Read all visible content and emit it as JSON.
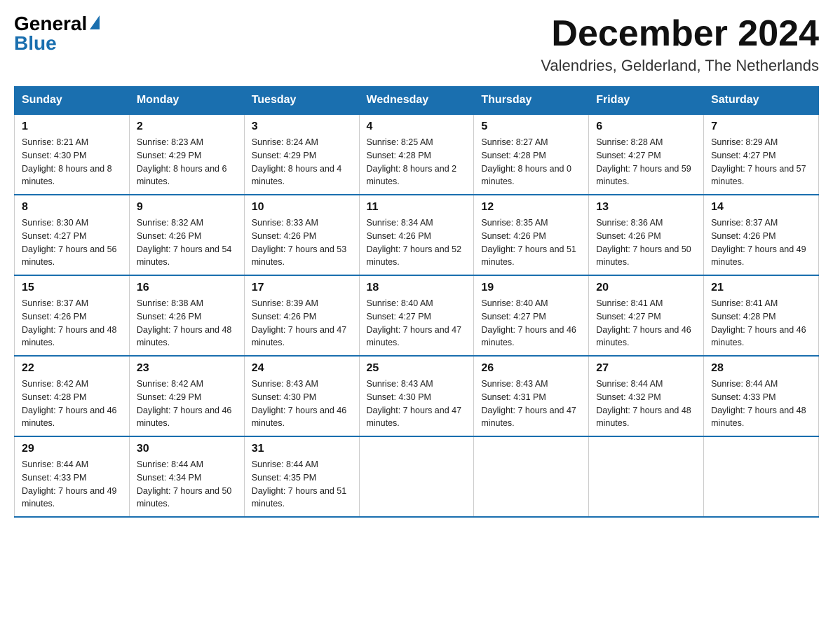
{
  "logo": {
    "general": "General",
    "blue": "Blue"
  },
  "title": {
    "month": "December 2024",
    "location": "Valendries, Gelderland, The Netherlands"
  },
  "weekdays": [
    "Sunday",
    "Monday",
    "Tuesday",
    "Wednesday",
    "Thursday",
    "Friday",
    "Saturday"
  ],
  "weeks": [
    [
      {
        "day": "1",
        "sunrise": "8:21 AM",
        "sunset": "4:30 PM",
        "daylight": "8 hours and 8 minutes."
      },
      {
        "day": "2",
        "sunrise": "8:23 AM",
        "sunset": "4:29 PM",
        "daylight": "8 hours and 6 minutes."
      },
      {
        "day": "3",
        "sunrise": "8:24 AM",
        "sunset": "4:29 PM",
        "daylight": "8 hours and 4 minutes."
      },
      {
        "day": "4",
        "sunrise": "8:25 AM",
        "sunset": "4:28 PM",
        "daylight": "8 hours and 2 minutes."
      },
      {
        "day": "5",
        "sunrise": "8:27 AM",
        "sunset": "4:28 PM",
        "daylight": "8 hours and 0 minutes."
      },
      {
        "day": "6",
        "sunrise": "8:28 AM",
        "sunset": "4:27 PM",
        "daylight": "7 hours and 59 minutes."
      },
      {
        "day": "7",
        "sunrise": "8:29 AM",
        "sunset": "4:27 PM",
        "daylight": "7 hours and 57 minutes."
      }
    ],
    [
      {
        "day": "8",
        "sunrise": "8:30 AM",
        "sunset": "4:27 PM",
        "daylight": "7 hours and 56 minutes."
      },
      {
        "day": "9",
        "sunrise": "8:32 AM",
        "sunset": "4:26 PM",
        "daylight": "7 hours and 54 minutes."
      },
      {
        "day": "10",
        "sunrise": "8:33 AM",
        "sunset": "4:26 PM",
        "daylight": "7 hours and 53 minutes."
      },
      {
        "day": "11",
        "sunrise": "8:34 AM",
        "sunset": "4:26 PM",
        "daylight": "7 hours and 52 minutes."
      },
      {
        "day": "12",
        "sunrise": "8:35 AM",
        "sunset": "4:26 PM",
        "daylight": "7 hours and 51 minutes."
      },
      {
        "day": "13",
        "sunrise": "8:36 AM",
        "sunset": "4:26 PM",
        "daylight": "7 hours and 50 minutes."
      },
      {
        "day": "14",
        "sunrise": "8:37 AM",
        "sunset": "4:26 PM",
        "daylight": "7 hours and 49 minutes."
      }
    ],
    [
      {
        "day": "15",
        "sunrise": "8:37 AM",
        "sunset": "4:26 PM",
        "daylight": "7 hours and 48 minutes."
      },
      {
        "day": "16",
        "sunrise": "8:38 AM",
        "sunset": "4:26 PM",
        "daylight": "7 hours and 48 minutes."
      },
      {
        "day": "17",
        "sunrise": "8:39 AM",
        "sunset": "4:26 PM",
        "daylight": "7 hours and 47 minutes."
      },
      {
        "day": "18",
        "sunrise": "8:40 AM",
        "sunset": "4:27 PM",
        "daylight": "7 hours and 47 minutes."
      },
      {
        "day": "19",
        "sunrise": "8:40 AM",
        "sunset": "4:27 PM",
        "daylight": "7 hours and 46 minutes."
      },
      {
        "day": "20",
        "sunrise": "8:41 AM",
        "sunset": "4:27 PM",
        "daylight": "7 hours and 46 minutes."
      },
      {
        "day": "21",
        "sunrise": "8:41 AM",
        "sunset": "4:28 PM",
        "daylight": "7 hours and 46 minutes."
      }
    ],
    [
      {
        "day": "22",
        "sunrise": "8:42 AM",
        "sunset": "4:28 PM",
        "daylight": "7 hours and 46 minutes."
      },
      {
        "day": "23",
        "sunrise": "8:42 AM",
        "sunset": "4:29 PM",
        "daylight": "7 hours and 46 minutes."
      },
      {
        "day": "24",
        "sunrise": "8:43 AM",
        "sunset": "4:30 PM",
        "daylight": "7 hours and 46 minutes."
      },
      {
        "day": "25",
        "sunrise": "8:43 AM",
        "sunset": "4:30 PM",
        "daylight": "7 hours and 47 minutes."
      },
      {
        "day": "26",
        "sunrise": "8:43 AM",
        "sunset": "4:31 PM",
        "daylight": "7 hours and 47 minutes."
      },
      {
        "day": "27",
        "sunrise": "8:44 AM",
        "sunset": "4:32 PM",
        "daylight": "7 hours and 48 minutes."
      },
      {
        "day": "28",
        "sunrise": "8:44 AM",
        "sunset": "4:33 PM",
        "daylight": "7 hours and 48 minutes."
      }
    ],
    [
      {
        "day": "29",
        "sunrise": "8:44 AM",
        "sunset": "4:33 PM",
        "daylight": "7 hours and 49 minutes."
      },
      {
        "day": "30",
        "sunrise": "8:44 AM",
        "sunset": "4:34 PM",
        "daylight": "7 hours and 50 minutes."
      },
      {
        "day": "31",
        "sunrise": "8:44 AM",
        "sunset": "4:35 PM",
        "daylight": "7 hours and 51 minutes."
      },
      null,
      null,
      null,
      null
    ]
  ]
}
